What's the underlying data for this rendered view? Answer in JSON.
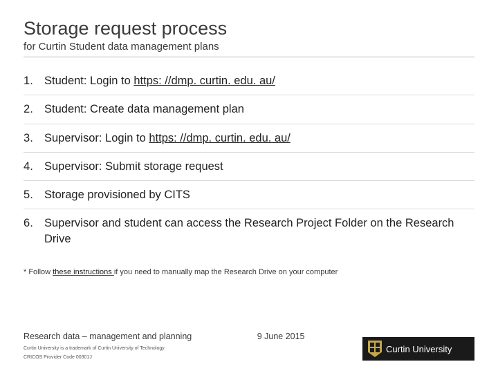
{
  "title": "Storage request process",
  "subtitle": "for Curtin Student data management plans",
  "steps": [
    {
      "prefix": "Student: Login to ",
      "link": "https: //dmp. curtin. edu. au/",
      "suffix": ""
    },
    {
      "prefix": "Student: Create data management plan",
      "link": "",
      "suffix": ""
    },
    {
      "prefix": "Supervisor: Login to ",
      "link": "https: //dmp. curtin. edu. au/",
      "suffix": ""
    },
    {
      "prefix": "Supervisor: Submit storage request",
      "link": "",
      "suffix": ""
    },
    {
      "prefix": "Storage provisioned by CITS",
      "link": "",
      "suffix": ""
    },
    {
      "prefix": "Supervisor and student can access the Research Project Folder on the Research Drive",
      "link": "",
      "suffix": ""
    }
  ],
  "footnote": {
    "pre": "* Follow ",
    "link": "these instructions ",
    "post": "if you need to manually map the Research Drive on your computer"
  },
  "footer": {
    "label": "Research data – management and planning",
    "date": "9 June 2015",
    "small1": "Curtin University is a trademark of Curtin University of Technology",
    "small2": "CRICOS Provider Code 00301J"
  },
  "logo": "Curtin University"
}
